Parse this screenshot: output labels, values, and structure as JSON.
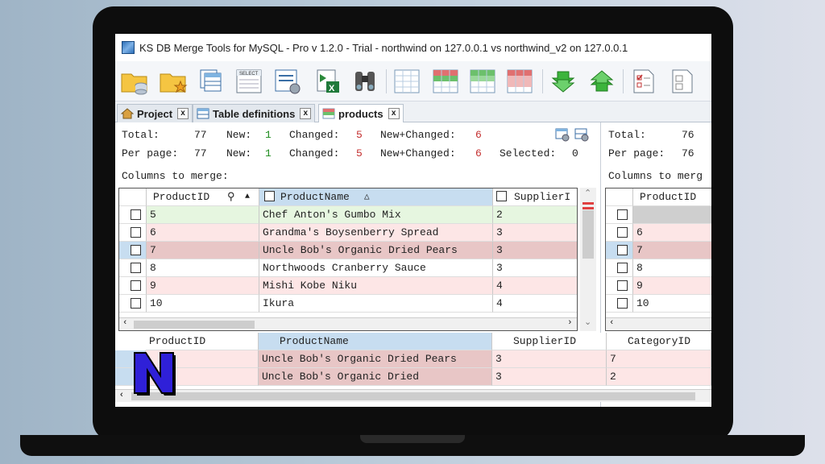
{
  "window": {
    "title": "KS DB Merge Tools for MySQL - Pro v 1.2.0 - Trial - northwind on 127.0.0.1 vs northwind_v2 on 127.0.0.1"
  },
  "toolbar": {
    "icons": [
      "open-db-icon",
      "open-project-icon",
      "tables-icon",
      "select-query-icon",
      "settings-list-icon",
      "export-excel-icon",
      "binoculars-icon",
      "grid-blank-icon",
      "grid-green-icon",
      "grid-green-top-icon",
      "grid-red-icon",
      "arrow-down-green-icon",
      "arrow-up-green-icon",
      "checklist-icon",
      "document-icon"
    ]
  },
  "tabs": [
    {
      "label": "Project",
      "close": "x"
    },
    {
      "label": "Table definitions",
      "close": "x"
    },
    {
      "label": "products",
      "close": "x"
    }
  ],
  "left_stats": {
    "total_label": "Total:",
    "total": "77",
    "new_label": "New:",
    "new": "1",
    "changed_label": "Changed:",
    "changed": "5",
    "newchanged_label": "New+Changed:",
    "newchanged": "6",
    "perpage_label": "Per page:",
    "perpage": "77",
    "new2": "1",
    "changed2": "5",
    "newchanged2": "6",
    "selected_label": "Selected:",
    "selected": "0",
    "columns_label": "Columns to merge:"
  },
  "right_stats": {
    "total_label": "Total:",
    "total": "76",
    "perpage_label": "Per page:",
    "perpage": "76",
    "columns_label": "Columns to merg"
  },
  "left_grid": {
    "headers": [
      "ProductID",
      "ProductName",
      "SupplierI"
    ],
    "rows": [
      {
        "id": "5",
        "name": "Chef Anton's Gumbo Mix",
        "supplier": "2",
        "state": "green"
      },
      {
        "id": "6",
        "name": "Grandma's Boysenberry Spread",
        "supplier": "3",
        "state": "pink"
      },
      {
        "id": "7",
        "name": "Uncle Bob's Organic Dried Pears",
        "supplier": "3",
        "state": "selected"
      },
      {
        "id": "8",
        "name": "Northwoods Cranberry Sauce",
        "supplier": "3",
        "state": "white"
      },
      {
        "id": "9",
        "name": "Mishi Kobe Niku",
        "supplier": "4",
        "state": "pink"
      },
      {
        "id": "10",
        "name": "Ikura",
        "supplier": "4",
        "state": "white"
      }
    ]
  },
  "right_grid": {
    "header": "ProductID",
    "rows": [
      "",
      "6",
      "7",
      "8",
      "9",
      "10"
    ]
  },
  "bottom_grid": {
    "headers": [
      "ProductID",
      "ProductName",
      "SupplierID",
      "CategoryID"
    ],
    "rows": [
      {
        "name": "Uncle Bob's Organic Dried Pears",
        "supplier": "3",
        "category": "7"
      },
      {
        "name": "Uncle Bob's Organic Dried",
        "supplier": "3",
        "category": "2"
      }
    ]
  },
  "logo": {
    "letter": "N",
    "color": "#2f20d8"
  }
}
